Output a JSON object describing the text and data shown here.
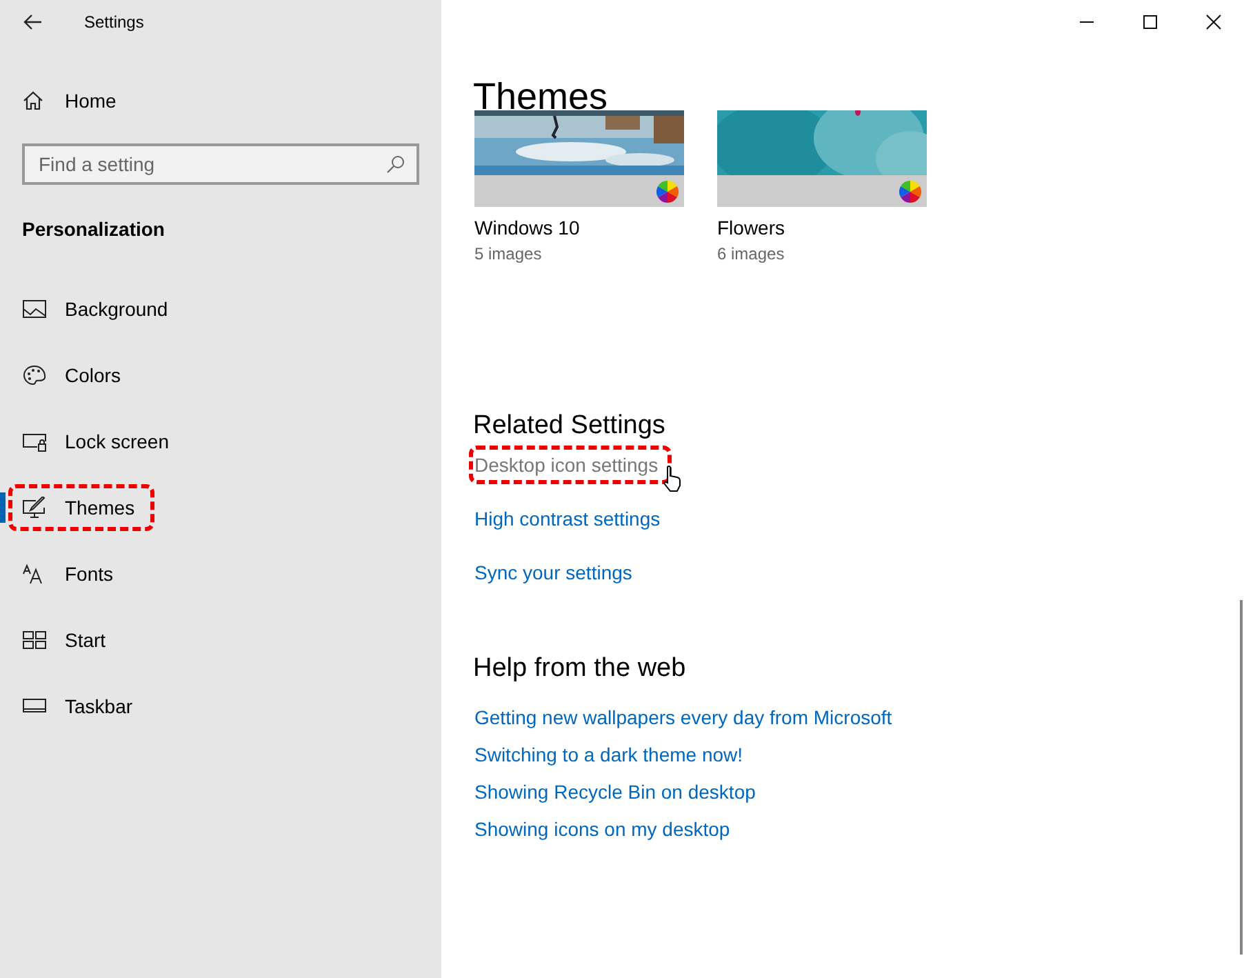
{
  "window": {
    "title": "Settings"
  },
  "sidebar": {
    "home": "Home",
    "search": {
      "placeholder": "Find a setting"
    },
    "section": "Personalization",
    "items": [
      {
        "label": "Background",
        "kind": "background",
        "selected": false,
        "highlighted": false
      },
      {
        "label": "Colors",
        "kind": "colors",
        "selected": false,
        "highlighted": false
      },
      {
        "label": "Lock screen",
        "kind": "lock",
        "selected": false,
        "highlighted": false
      },
      {
        "label": "Themes",
        "kind": "themes",
        "selected": true,
        "highlighted": true
      },
      {
        "label": "Fonts",
        "kind": "fonts",
        "selected": false,
        "highlighted": false
      },
      {
        "label": "Start",
        "kind": "start",
        "selected": false,
        "highlighted": false
      },
      {
        "label": "Taskbar",
        "kind": "taskbar",
        "selected": false,
        "highlighted": false
      }
    ]
  },
  "main": {
    "title": "Themes",
    "themes": [
      {
        "name": "Windows 10",
        "count": "5 images",
        "kind": "lake"
      },
      {
        "name": "Flowers",
        "count": "6 images",
        "kind": "flower"
      }
    ],
    "related": {
      "heading": "Related Settings",
      "links": [
        {
          "label": "Desktop icon settings",
          "hovered": true,
          "highlighted": true
        },
        {
          "label": "High contrast settings",
          "hovered": false,
          "highlighted": false
        },
        {
          "label": "Sync your settings",
          "hovered": false,
          "highlighted": false
        }
      ]
    },
    "help": {
      "heading": "Help from the web",
      "links": [
        "Getting new wallpapers every day from Microsoft",
        "Switching to a dark theme now!",
        "Showing Recycle Bin on desktop",
        "Showing icons on my desktop"
      ]
    }
  }
}
